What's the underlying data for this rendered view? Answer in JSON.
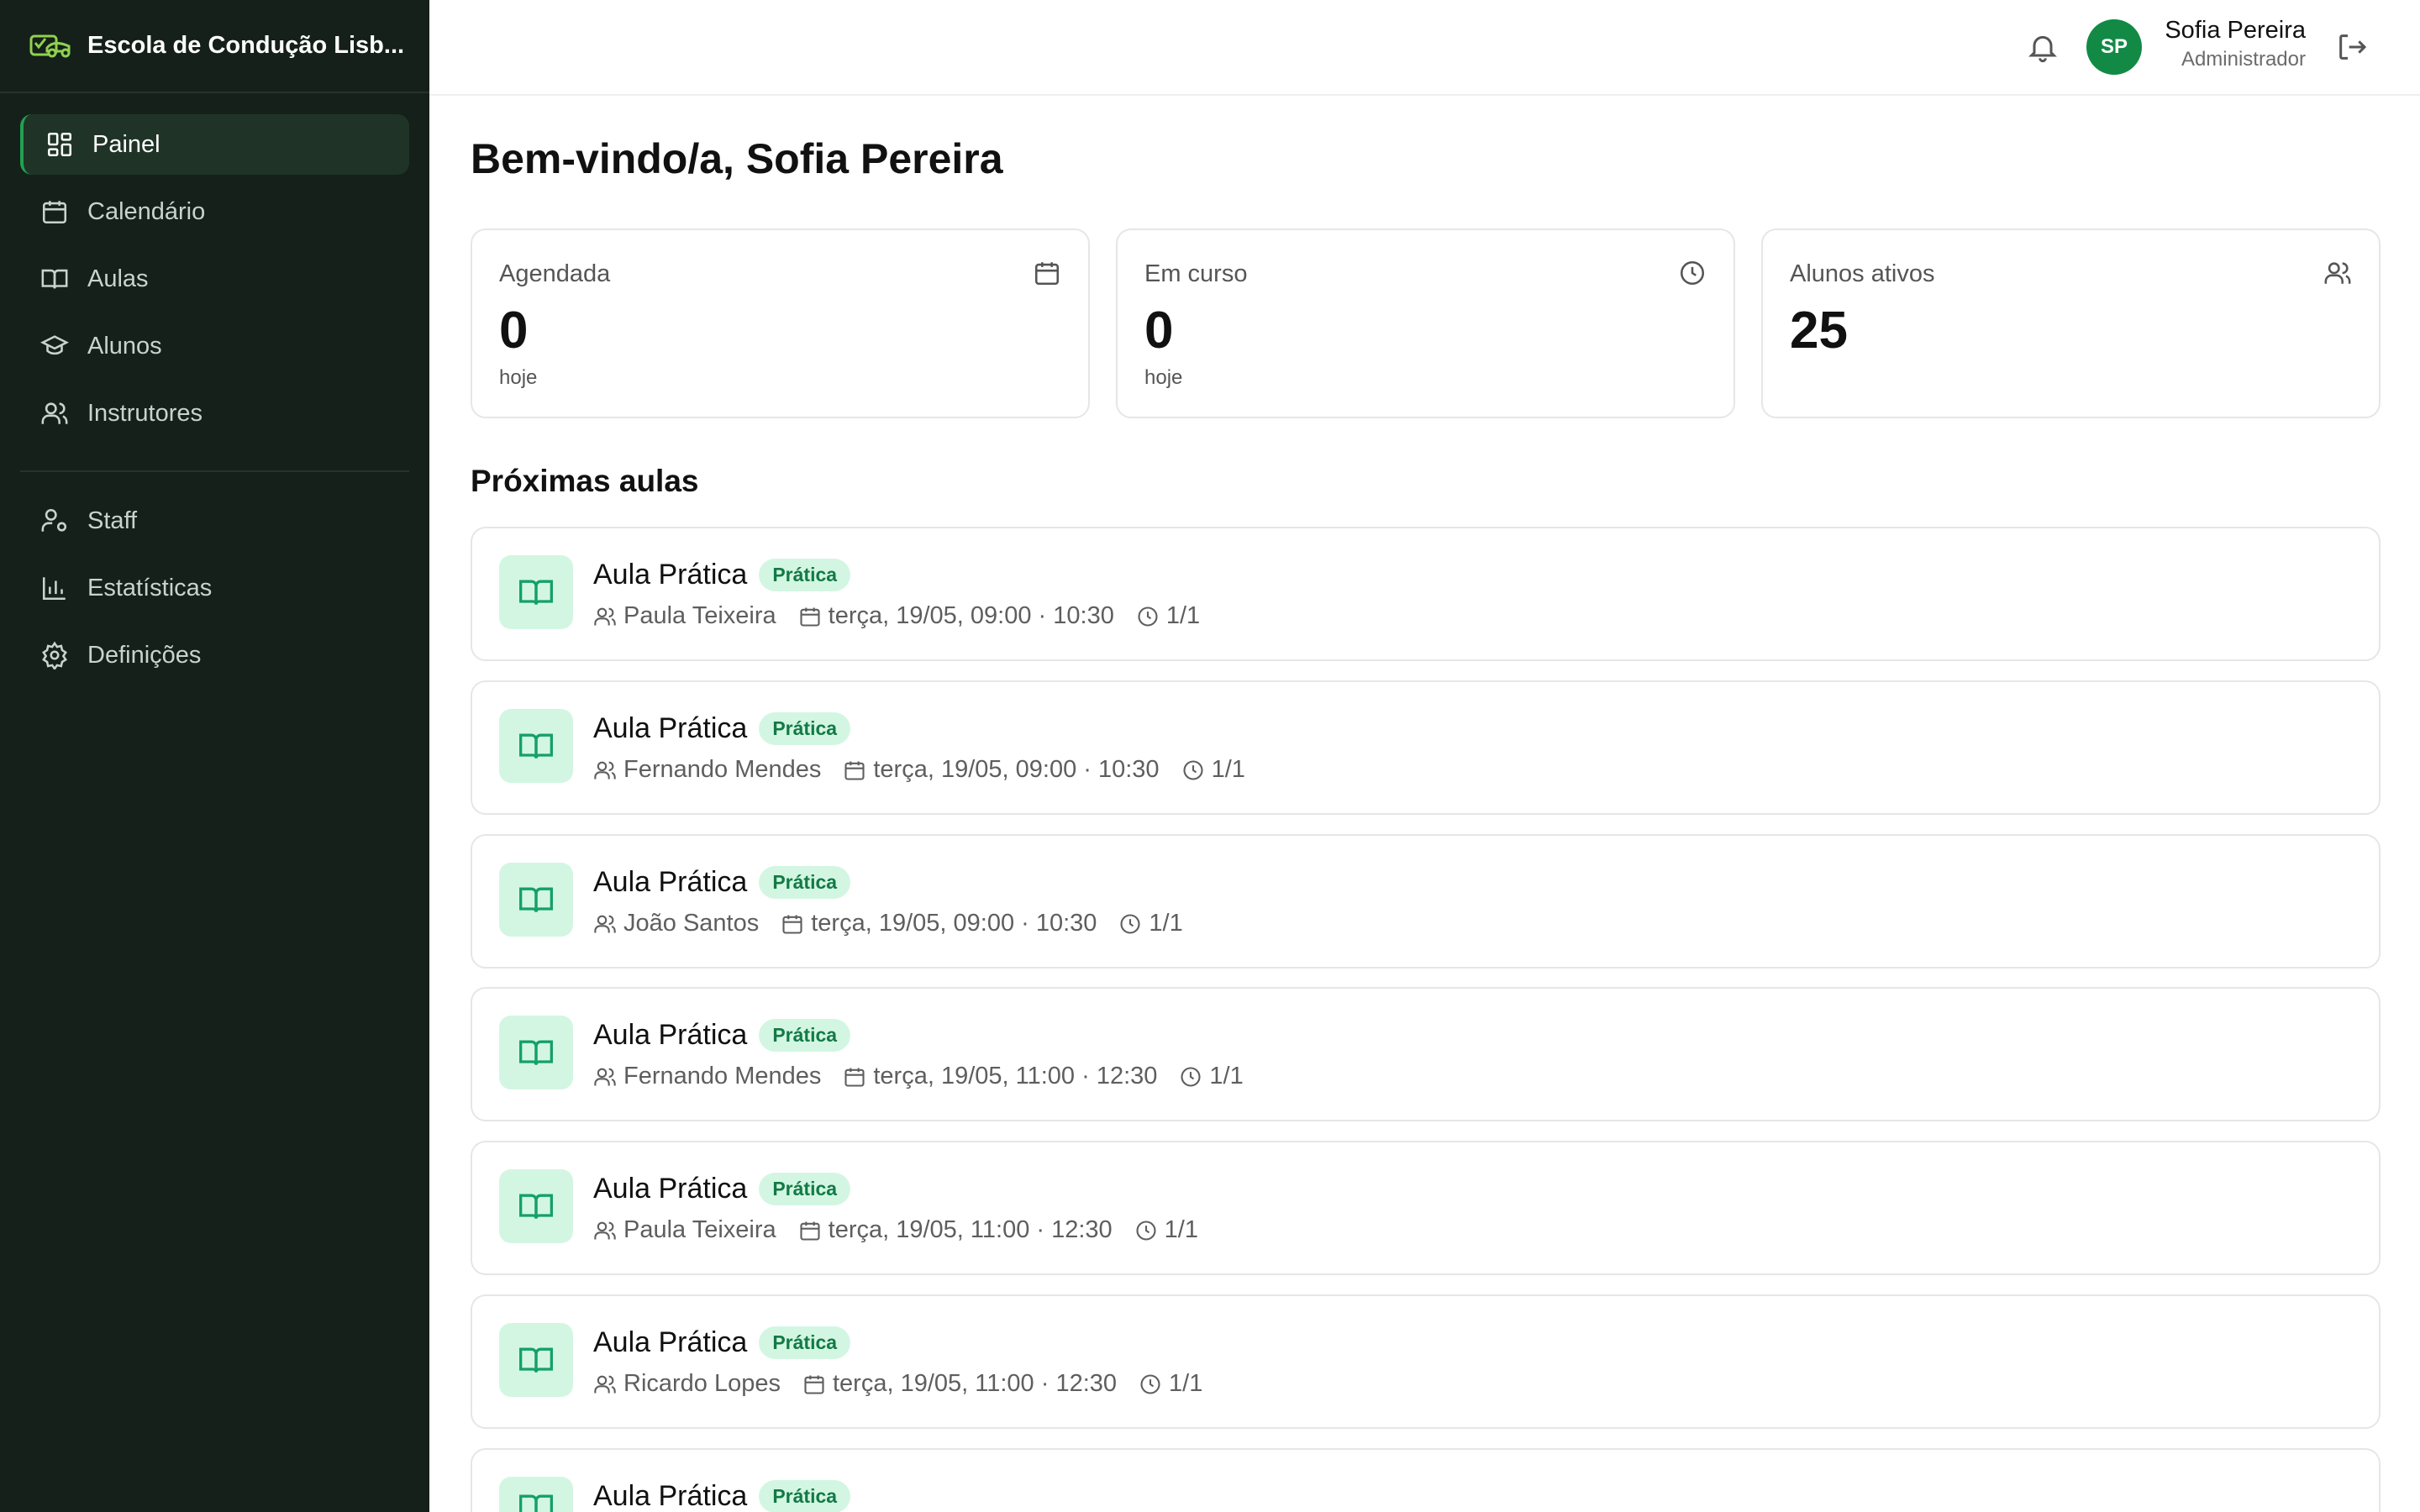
{
  "app": {
    "name": "Escola de Condução Lisb..."
  },
  "sidebar": {
    "items": [
      {
        "label": "Painel",
        "icon": "dashboard-icon",
        "active": true
      },
      {
        "label": "Calendário",
        "icon": "calendar-icon"
      },
      {
        "label": "Aulas",
        "icon": "book-icon"
      },
      {
        "label": "Alunos",
        "icon": "graduation-cap-icon"
      },
      {
        "label": "Instrutores",
        "icon": "users-icon"
      }
    ],
    "secondary": [
      {
        "label": "Staff",
        "icon": "user-cog-icon"
      },
      {
        "label": "Estatísticas",
        "icon": "bar-chart-icon"
      },
      {
        "label": "Definições",
        "icon": "gear-icon"
      }
    ]
  },
  "header": {
    "user": {
      "initials": "SP",
      "name": "Sofia Pereira",
      "role": "Administrador"
    }
  },
  "page": {
    "title": "Bem-vindo/a, Sofia Pereira"
  },
  "stats": [
    {
      "label": "Agendada",
      "value": "0",
      "sub": "hoje",
      "icon": "calendar-icon"
    },
    {
      "label": "Em curso",
      "value": "0",
      "sub": "hoje",
      "icon": "clock-icon"
    },
    {
      "label": "Alunos ativos",
      "value": "25",
      "sub": "",
      "icon": "users-icon"
    }
  ],
  "upcoming": {
    "title": "Próximas aulas",
    "lessons": [
      {
        "title": "Aula Prática",
        "badge": "Prática",
        "student": "Paula Teixeira",
        "datetime": "terça, 19/05, 09:00 · 10:30",
        "count": "1/1"
      },
      {
        "title": "Aula Prática",
        "badge": "Prática",
        "student": "Fernando Mendes",
        "datetime": "terça, 19/05, 09:00 · 10:30",
        "count": "1/1"
      },
      {
        "title": "Aula Prática",
        "badge": "Prática",
        "student": "João Santos",
        "datetime": "terça, 19/05, 09:00 · 10:30",
        "count": "1/1"
      },
      {
        "title": "Aula Prática",
        "badge": "Prática",
        "student": "Fernando Mendes",
        "datetime": "terça, 19/05, 11:00 · 12:30",
        "count": "1/1"
      },
      {
        "title": "Aula Prática",
        "badge": "Prática",
        "student": "Paula Teixeira",
        "datetime": "terça, 19/05, 11:00 · 12:30",
        "count": "1/1"
      },
      {
        "title": "Aula Prática",
        "badge": "Prática",
        "student": "Ricardo Lopes",
        "datetime": "terça, 19/05, 11:00 · 12:30",
        "count": "1/1"
      },
      {
        "title": "Aula Prática",
        "badge": "Prática"
      }
    ]
  },
  "colors": {
    "sidebar_bg": "#142019",
    "accent": "#22a052",
    "avatar_bg": "#128a45",
    "badge_bg": "#d3f6e3",
    "badge_text": "#127a45"
  }
}
